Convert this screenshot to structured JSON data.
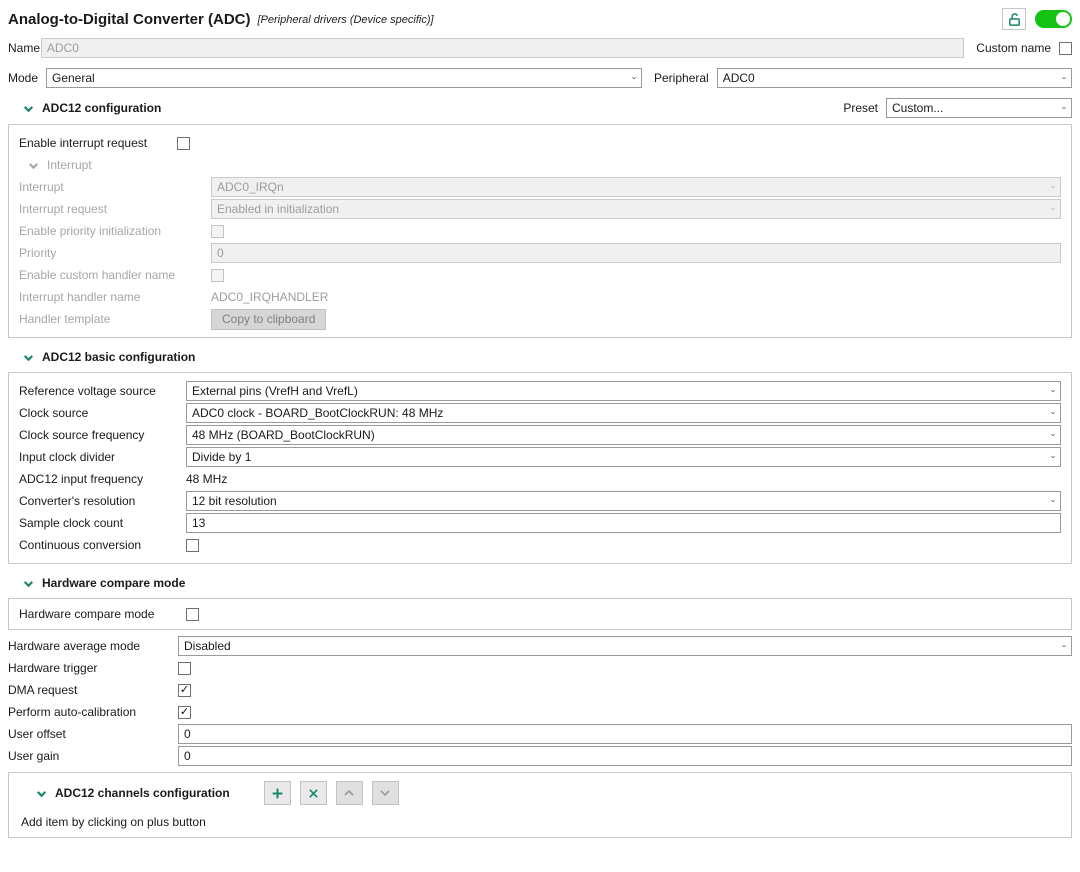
{
  "header": {
    "title": "Analog-to-Digital Converter (ADC)",
    "subtitle": "[Peripheral drivers (Device specific)]",
    "toggle_state": "on"
  },
  "identity": {
    "name_label": "Name",
    "name_value": "ADC0",
    "custom_name_label": "Custom name",
    "custom_name_checked": "",
    "mode_label": "Mode",
    "mode_value": "General",
    "peripheral_label": "Peripheral",
    "peripheral_value": "ADC0"
  },
  "config_section": {
    "title": "ADC12 configuration",
    "preset_label": "Preset",
    "preset_value": "Custom..."
  },
  "interrupt": {
    "enable_irq_label": "Enable interrupt request",
    "enable_irq_checked": "",
    "section_title": "Interrupt",
    "interrupt_label": "Interrupt",
    "interrupt_value": "ADC0_IRQn",
    "request_label": "Interrupt request",
    "request_value": "Enabled in initialization",
    "priority_init_label": "Enable priority initialization",
    "priority_init_checked": "",
    "priority_label": "Priority",
    "priority_value": "0",
    "custom_handler_label": "Enable custom handler name",
    "custom_handler_checked": "",
    "handler_name_label": "Interrupt handler name",
    "handler_name_value": "ADC0_IRQHANDLER",
    "handler_template_label": "Handler template",
    "copy_button_label": "Copy to clipboard"
  },
  "basic": {
    "title": "ADC12 basic configuration",
    "rows": {
      "ref_voltage": {
        "label": "Reference voltage source",
        "value": "External pins (VrefH and VrefL)"
      },
      "clock_source": {
        "label": "Clock source",
        "value": "ADC0 clock - BOARD_BootClockRUN: 48 MHz"
      },
      "clock_freq": {
        "label": "Clock source frequency",
        "value": "48 MHz (BOARD_BootClockRUN)"
      },
      "divider": {
        "label": "Input clock divider",
        "value": "Divide by 1"
      },
      "input_freq": {
        "label": "ADC12 input frequency",
        "value": "48 MHz"
      },
      "resolution": {
        "label": "Converter's resolution",
        "value": "12 bit resolution"
      },
      "sample_count": {
        "label": "Sample clock count",
        "value": "13"
      },
      "continuous": {
        "label": "Continuous conversion",
        "checked": ""
      }
    }
  },
  "compare": {
    "title": "Hardware compare mode",
    "row_label": "Hardware compare mode",
    "checked": ""
  },
  "misc": {
    "avg_label": "Hardware average mode",
    "avg_value": "Disabled",
    "trigger_label": "Hardware trigger",
    "trigger_checked": "",
    "dma_label": "DMA request",
    "dma_checked": "✓",
    "calib_label": "Perform auto-calibration",
    "calib_checked": "✓",
    "offset_label": "User offset",
    "offset_value": "0",
    "gain_label": "User gain",
    "gain_value": "0"
  },
  "channels": {
    "title": "ADC12 channels configuration",
    "hint": "Add item by clicking on plus button"
  },
  "icons": {
    "header_lock": "unlock",
    "section_expander": "chevron-down",
    "combo_arrow": "chevron-down",
    "toolbar": [
      "plus",
      "x",
      "chevron-up",
      "chevron-down"
    ]
  },
  "colors": {
    "accent": "#17866c",
    "toggle_on": "#12c312",
    "panel_border": "#c8c8c8",
    "disabled_text": "#9d9d9d",
    "disabled_bg": "#f0f0f0"
  }
}
